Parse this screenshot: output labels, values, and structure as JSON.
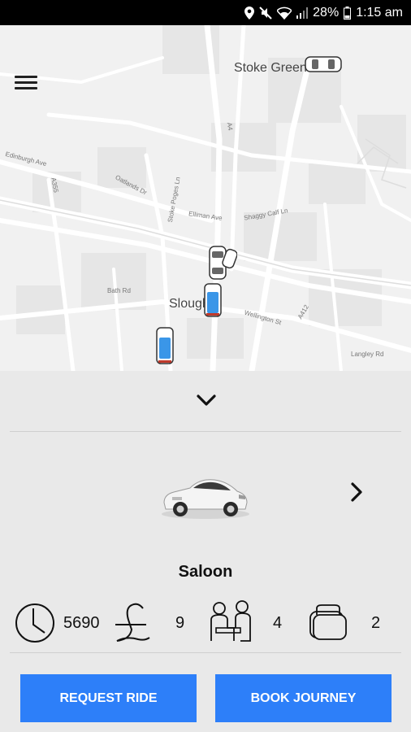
{
  "status_bar": {
    "battery": "28%",
    "time": "1:15 am"
  },
  "map": {
    "places": [
      "Stoke Green",
      "Slough"
    ],
    "streets": [
      "Edinburgh Ave",
      "Oatlands Dr",
      "Stoke Poges Ln",
      "Elliman Ave",
      "Shaggy Calf Ln",
      "Wellington St",
      "Bath Rd",
      "Langley Rd",
      "A355",
      "A4",
      "A412"
    ]
  },
  "vehicle": {
    "name": "Saloon",
    "distance": "5690",
    "price": "9",
    "passengers": "4",
    "luggage": "2"
  },
  "buttons": {
    "request": "REQUEST RIDE",
    "book": "BOOK JOURNEY"
  }
}
